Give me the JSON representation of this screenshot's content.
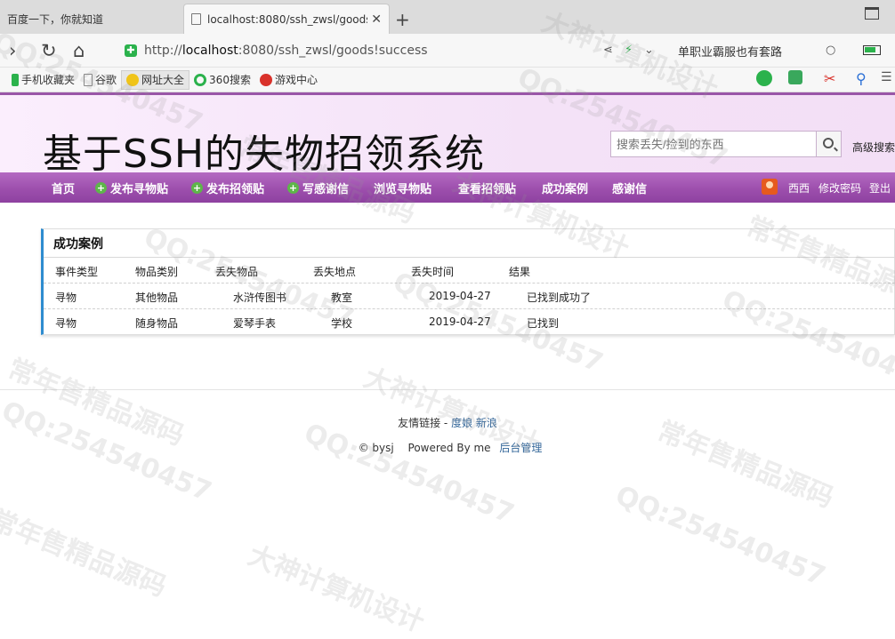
{
  "browser": {
    "tabs": [
      {
        "title": "百度一下，你就知道",
        "active": false
      },
      {
        "title": "localhost:8080/ssh_zwsl/goods!success",
        "active": true
      }
    ],
    "url_prefix": "http://",
    "url_host": "localhost",
    "url_rest": ":8080/ssh_zwsl/goods!success",
    "search_text": "单职业霸服也有套路",
    "bookmarks": [
      {
        "label": "手机收藏夹",
        "icon": "phone-icon"
      },
      {
        "label": "谷歌",
        "icon": "page-icon"
      },
      {
        "label": "网址大全",
        "icon": "navigator-icon"
      },
      {
        "label": "360搜索",
        "icon": "search360-icon"
      },
      {
        "label": "游戏中心",
        "icon": "game-icon"
      }
    ]
  },
  "site": {
    "title": "基于SSH的失物招领系统",
    "search_placeholder": "搜索丢失/捡到的东西",
    "advanced_search": "高级搜索",
    "nav": [
      {
        "label": "首页",
        "plus": false
      },
      {
        "label": "发布寻物贴",
        "plus": true
      },
      {
        "label": "发布招领贴",
        "plus": true
      },
      {
        "label": "写感谢信",
        "plus": true
      },
      {
        "label": "浏览寻物贴",
        "plus": false
      },
      {
        "label": "查看招领贴",
        "plus": false
      },
      {
        "label": "成功案例",
        "plus": false
      },
      {
        "label": "感谢信",
        "plus": false
      }
    ],
    "user": {
      "name": "西西",
      "change_password": "修改密码",
      "logout": "登出"
    }
  },
  "panel": {
    "title": "成功案例",
    "columns": [
      "事件类型",
      "物品类别",
      "丢失物品",
      "丢失地点",
      "丢失时间",
      "结果"
    ],
    "rows": [
      [
        "寻物",
        "其他物品",
        "水浒传图书",
        "教室",
        "2019-04-27",
        "已找到成功了"
      ],
      [
        "寻物",
        "随身物品",
        "爱琴手表",
        "学校",
        "2019-04-27",
        "已找到"
      ]
    ]
  },
  "footer": {
    "links_label": "友情链接 -",
    "links": [
      "度娘",
      "新浪"
    ],
    "copyright": "© bysj",
    "powered": "Powered By me",
    "admin": "后台管理"
  },
  "watermarks": [
    "QQ:254540457",
    "大神计算机设计",
    "常年售精品源码"
  ],
  "colors": {
    "nav": "#9d4fad",
    "header": "#f4e2f7",
    "panel_accent": "#2e8ccf",
    "plus_icon": "#5eb64a"
  }
}
